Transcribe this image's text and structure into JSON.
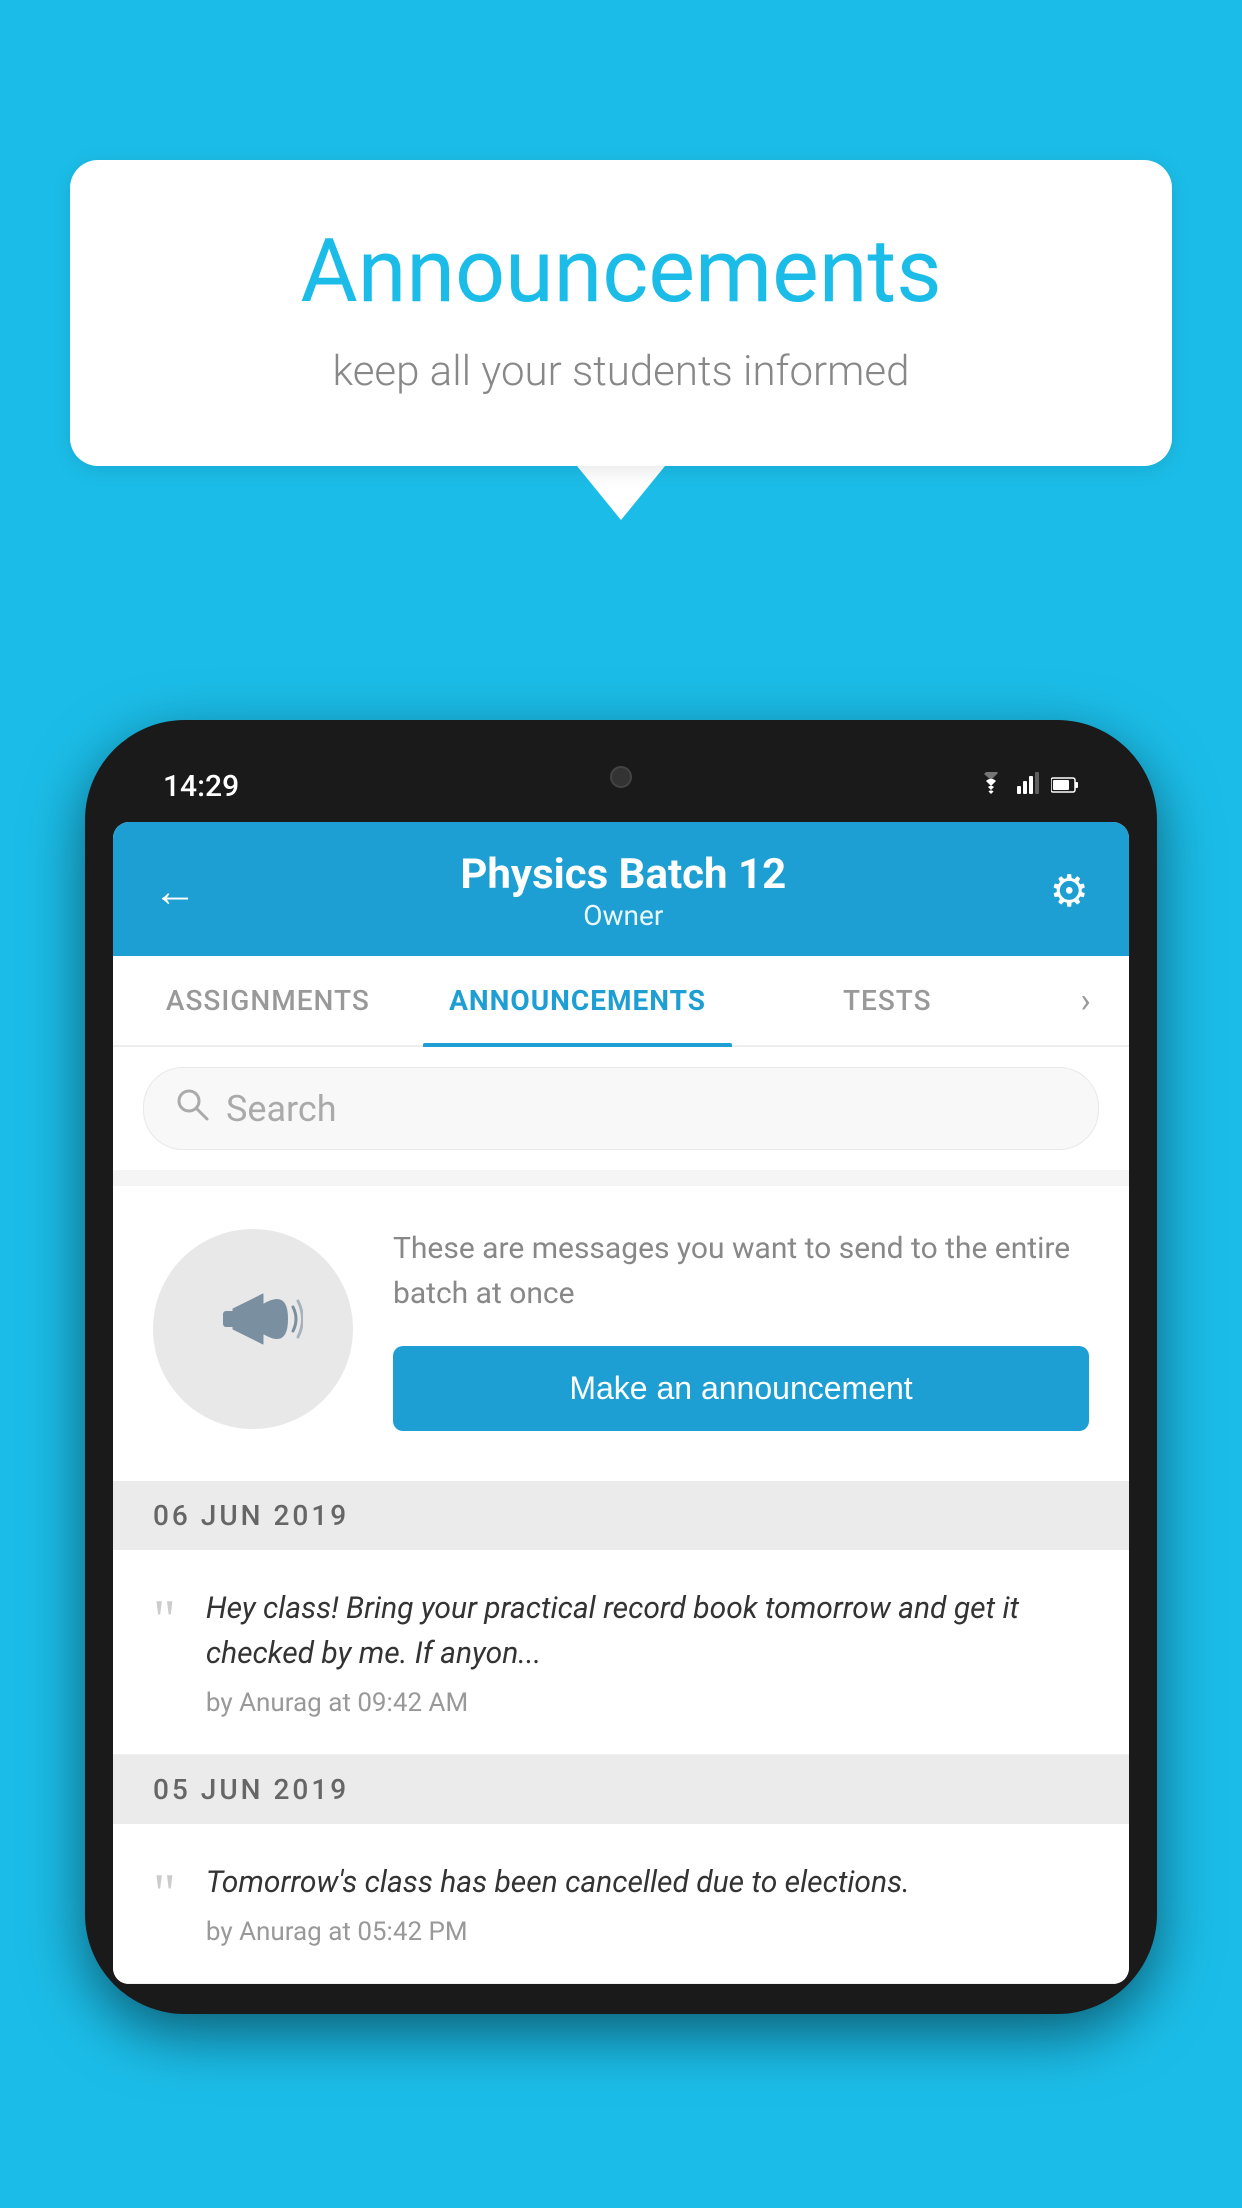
{
  "background_color": "#1BBDE8",
  "speech_bubble": {
    "title": "Announcements",
    "subtitle": "keep all your students informed"
  },
  "phone": {
    "status_bar": {
      "time": "14:29",
      "wifi": "▼",
      "signal": "▲",
      "battery": "▮"
    },
    "header": {
      "title": "Physics Batch 12",
      "subtitle": "Owner",
      "back_label": "←",
      "gear_label": "⚙"
    },
    "tabs": [
      {
        "label": "ASSIGNMENTS",
        "active": false
      },
      {
        "label": "ANNOUNCEMENTS",
        "active": true
      },
      {
        "label": "TESTS",
        "active": false
      }
    ],
    "search": {
      "placeholder": "Search"
    },
    "promo": {
      "description": "These are messages you want to send to the entire batch at once",
      "button_label": "Make an announcement"
    },
    "announcements": [
      {
        "date": "06  JUN  2019",
        "text": "Hey class! Bring your practical record book tomorrow and get it checked by me. If anyon...",
        "meta": "by Anurag at 09:42 AM"
      },
      {
        "date": "05  JUN  2019",
        "text": "Tomorrow's class has been cancelled due to elections.",
        "meta": "by Anurag at 05:42 PM"
      }
    ]
  }
}
